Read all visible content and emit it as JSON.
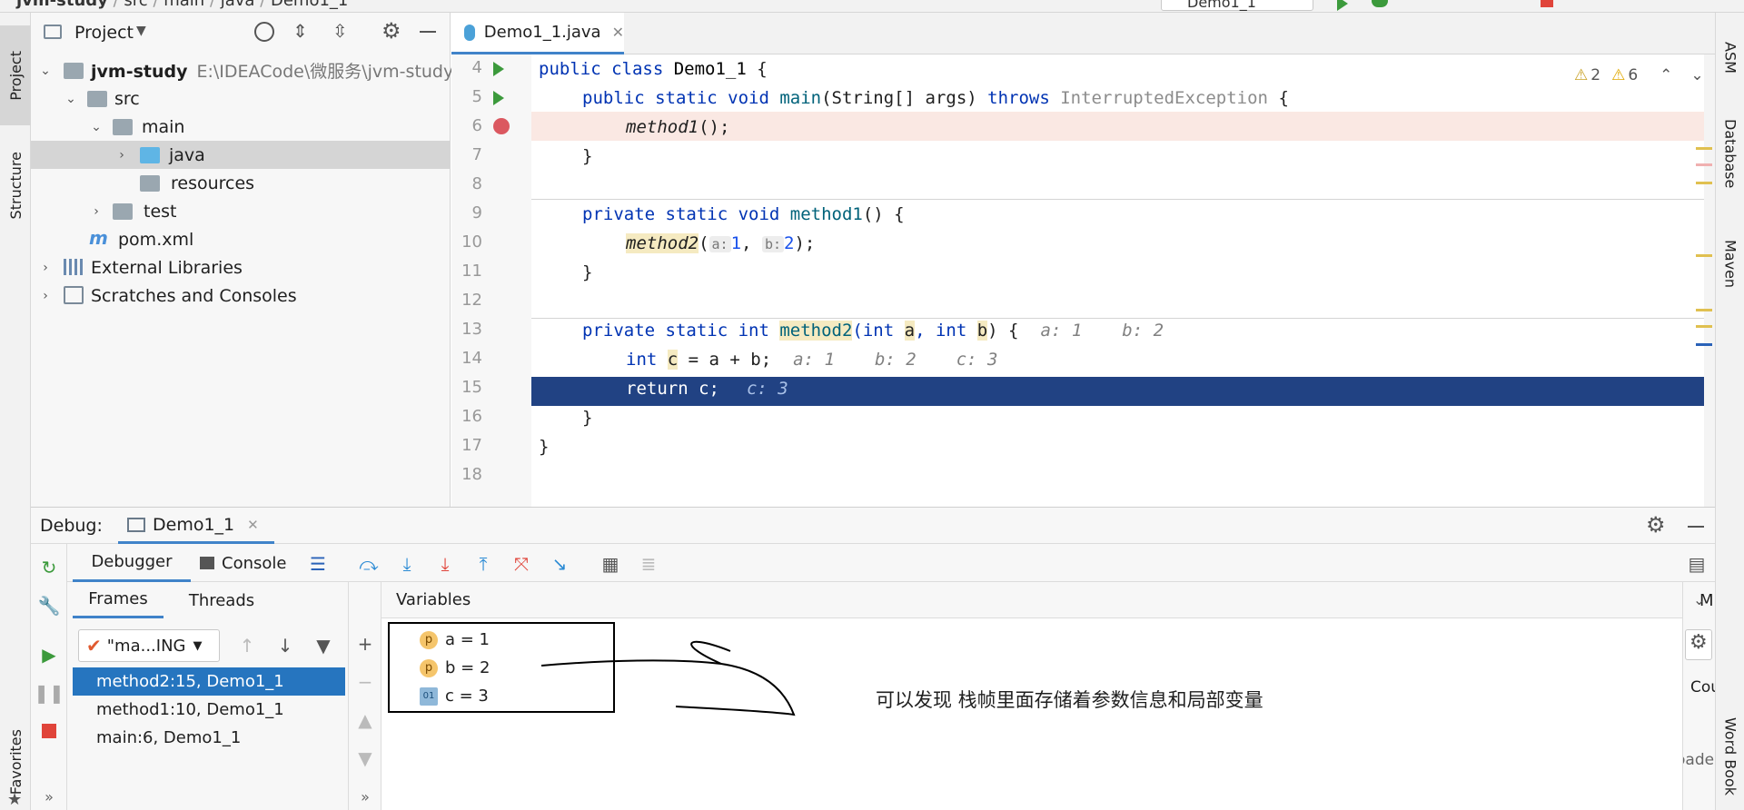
{
  "topbar": {
    "crumbs": [
      "jvm-study",
      "src",
      "main",
      "java",
      "Demo1_1"
    ],
    "run_config": "Demo1_1"
  },
  "left_strip": {
    "project": "Project",
    "structure": "Structure",
    "favorites": "Favorites"
  },
  "right_strip": {
    "asm": "ASM",
    "database": "Database",
    "maven": "Maven",
    "word_book": "Word Book"
  },
  "project_panel": {
    "title": "Project",
    "tree": [
      {
        "label": "jvm-study",
        "path": "E:\\IDEACode\\微服务\\jvm-study"
      },
      {
        "label": "src"
      },
      {
        "label": "main"
      },
      {
        "label": "java"
      },
      {
        "label": "resources"
      },
      {
        "label": "test"
      },
      {
        "label": "pom.xml"
      },
      {
        "label": "External Libraries"
      },
      {
        "label": "Scratches and Consoles"
      }
    ]
  },
  "editor": {
    "tab": "Demo1_1.java",
    "warnings": {
      "a": "2",
      "b": "6"
    },
    "line_numbers": [
      "4",
      "5",
      "6",
      "7",
      "8",
      "9",
      "10",
      "11",
      "12",
      "13",
      "14",
      "15",
      "16",
      "17",
      "18"
    ],
    "lines": {
      "l4": [
        "public class ",
        "Demo1_1",
        " {"
      ],
      "l5": [
        "public static void ",
        "main",
        "(String[] args) ",
        "throws ",
        "InterruptedException",
        " {"
      ],
      "l6": [
        "method1",
        "();"
      ],
      "l7": "}",
      "l9": [
        "private static void ",
        "method1",
        "() {"
      ],
      "l10": [
        "method2",
        "(",
        "a:",
        "1",
        ", ",
        "b:",
        "2",
        ");"
      ],
      "l11": "}",
      "l13": [
        "private static int ",
        "method2",
        "(int ",
        "a",
        ", int ",
        "b",
        ") {",
        "a: 1",
        "b: 2"
      ],
      "l14": [
        "int ",
        "c",
        " = a + b;",
        "a: 1",
        "b: 2",
        "c: 3"
      ],
      "l15": [
        "return c;",
        "c: 3"
      ],
      "l16": "}",
      "l17": "}"
    }
  },
  "debug": {
    "label": "Debug:",
    "session_tab": "Demo1_1",
    "tabs": {
      "debugger": "Debugger",
      "console": "Console"
    },
    "subtabs": {
      "frames": "Frames",
      "threads": "Threads"
    },
    "thread_select": "\"ma...ING",
    "frames": [
      "method2:15, Demo1_1",
      "method1:10, Demo1_1",
      "main:6, Demo1_1"
    ],
    "variables_title": "Variables",
    "variables": [
      {
        "badge": "p",
        "text": "a = 1"
      },
      {
        "badge": "p",
        "text": "b = 2"
      },
      {
        "badge": "01",
        "text": "c = 3"
      }
    ],
    "annotation": "可以发现 栈帧里面存储着参数信息和局部变量",
    "right_partial": {
      "col": "M",
      "count": "Cour",
      "loaded": "oaded. L"
    }
  },
  "colors": {
    "accent": "#2675bf",
    "current_line": "#214283",
    "breakpoint_line": "#fae8e3",
    "warning": "#e0a800"
  }
}
